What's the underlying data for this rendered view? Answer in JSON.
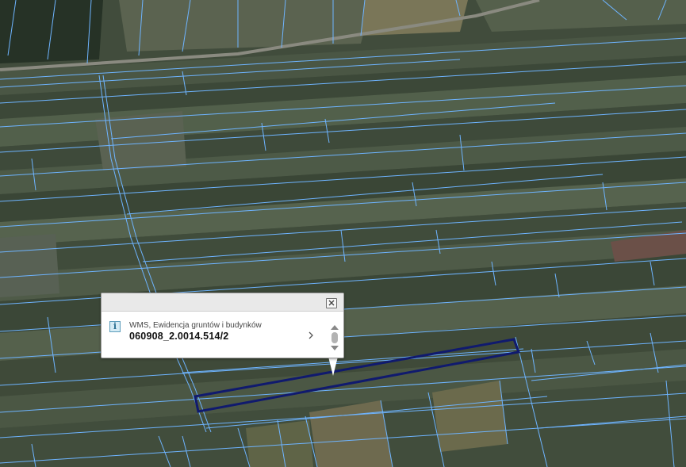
{
  "popup": {
    "layer_name": "WMS, Ewidencja gruntów i budynków",
    "parcel_id": "060908_2.0014.514/2",
    "info_icon": "info-icon",
    "close_icon": "close-icon",
    "next_icon": "chevron-right-icon"
  },
  "colors": {
    "parcel_lines": "#6eb4ff",
    "selected_parcel": "#101a6e",
    "popup_bg": "#ffffff"
  }
}
